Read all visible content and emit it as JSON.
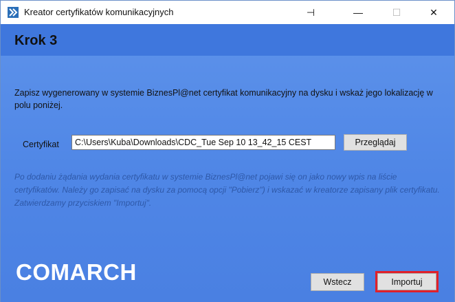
{
  "window": {
    "title": "Kreator certyfikatów komunikacyjnych",
    "pin_glyph": "⊣",
    "minimize_glyph": "—",
    "maximize_glyph": "☐",
    "close_glyph": "✕"
  },
  "step": {
    "title": "Krok 3"
  },
  "instructions": "Zapisz wygenerowany w systemie BiznesPl@net certyfikat komunikacyjny na dysku i wskaż jego lokalizację w polu poniżej.",
  "certificate": {
    "label": "Certyfikat",
    "value": "C:\\Users\\Kuba\\Downloads\\CDC_Tue Sep 10 13_42_15 CEST",
    "browse_label": "Przeglądaj"
  },
  "hint": "Po dodaniu żądania wydania certyfikatu w systemie BiznesPl@net pojawi się on jako nowy wpis na liście certyfikatów. Należy go zapisać na dysku za pomocą opcji \"Pobierz\") i wskazać w kreatorze zapisany plik certyfikatu. Zatwierdzamy przyciskiem \"Importuj\".",
  "footer": {
    "logo": "COMARCH",
    "back_label": "Wstecz",
    "import_label": "Importuj"
  },
  "colors": {
    "background": "#4f86e6",
    "step_bar": "#3f77dd",
    "hint_text": "#2e58a8",
    "highlight": "#e0202a"
  }
}
